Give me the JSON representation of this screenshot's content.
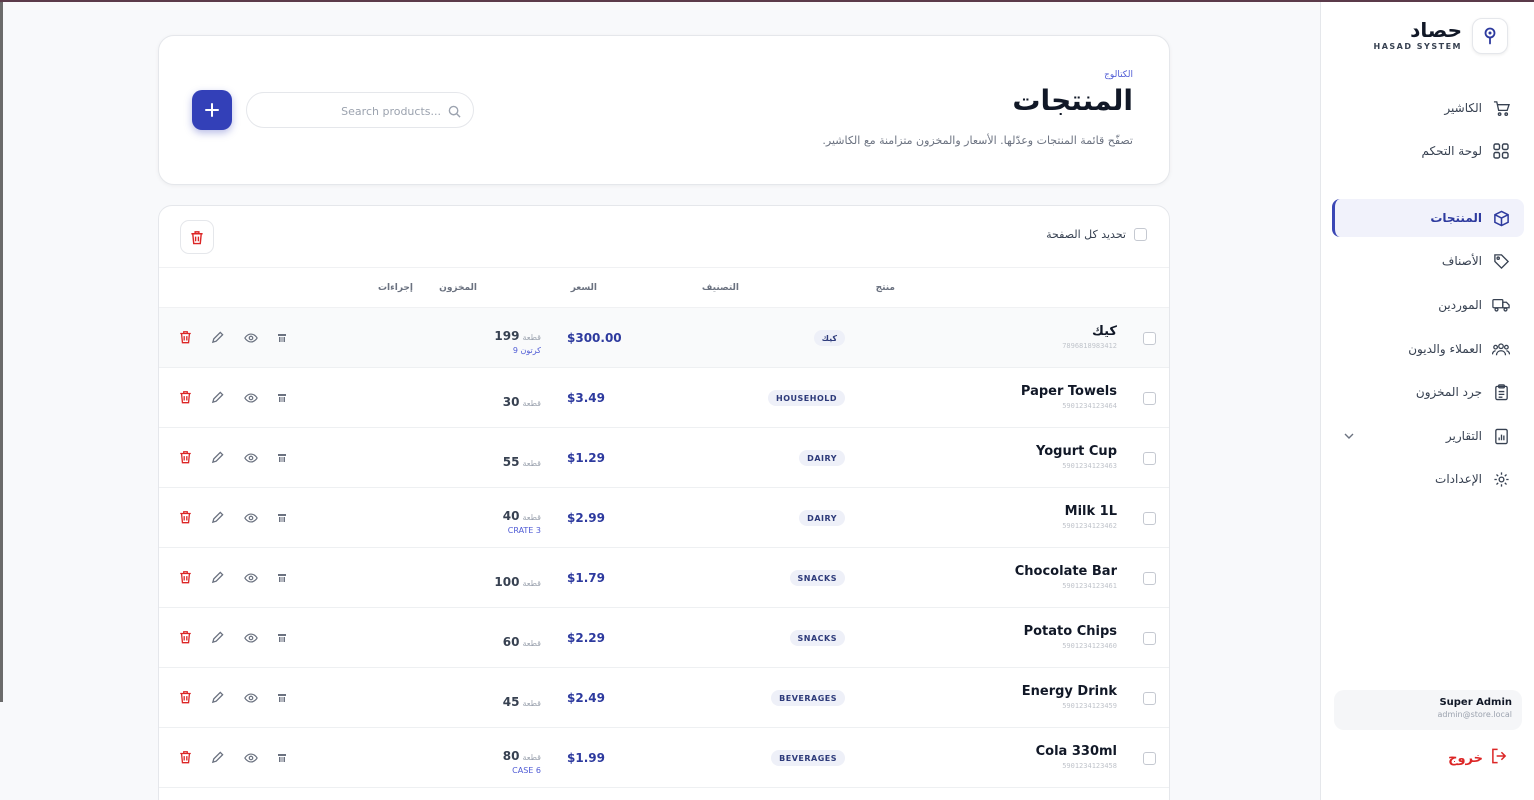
{
  "brand": {
    "name": "حصاد",
    "sub": "HASAD SYSTEM"
  },
  "nav": [
    {
      "label": "الكاشير",
      "icon": "cart-icon"
    },
    {
      "label": "لوحة التحكم",
      "icon": "grid-icon"
    },
    {
      "label": "المنتجات",
      "icon": "box-icon",
      "active": true
    },
    {
      "label": "الأصناف",
      "icon": "tag-icon"
    },
    {
      "label": "الموردين",
      "icon": "truck-icon"
    },
    {
      "label": "العملاء والديون",
      "icon": "users-icon"
    },
    {
      "label": "جرد المخزون",
      "icon": "clipboard-icon"
    },
    {
      "label": "التقارير",
      "icon": "chart-file-icon",
      "expandable": true
    },
    {
      "label": "الإعدادات",
      "icon": "gear-icon"
    }
  ],
  "user": {
    "name": "Super Admin",
    "email": "admin@store.local"
  },
  "logout_label": "خروج",
  "header": {
    "crumb": "الكتالوج",
    "title": "المنتجات",
    "description": "تصفّح قائمة المنتجات وعدّلها. الأسعار والمخزون متزامنة مع الكاشير.",
    "search_placeholder": "Search products..."
  },
  "table": {
    "select_all_label": "تحديد كل الصفحة",
    "columns": {
      "product": "منتج",
      "category": "التصنيف",
      "price": "السعر",
      "stock": "المخزون",
      "actions": "إجراءات"
    },
    "rows": [
      {
        "name": "كيك",
        "code": "7896818983412",
        "category": "كيك",
        "price": "$300.00",
        "qty": "199",
        "unit": "قطعة",
        "pack": "9 كرتون"
      },
      {
        "name": "Paper Towels",
        "code": "5901234123464",
        "category": "HOUSEHOLD",
        "price": "$3.49",
        "qty": "30",
        "unit": "قطعة",
        "pack": ""
      },
      {
        "name": "Yogurt Cup",
        "code": "5901234123463",
        "category": "DAIRY",
        "price": "$1.29",
        "qty": "55",
        "unit": "قطعة",
        "pack": ""
      },
      {
        "name": "Milk 1L",
        "code": "5901234123462",
        "category": "DAIRY",
        "price": "$2.99",
        "qty": "40",
        "unit": "قطعة",
        "pack": "CRATE 3"
      },
      {
        "name": "Chocolate Bar",
        "code": "5901234123461",
        "category": "SNACKS",
        "price": "$1.79",
        "qty": "100",
        "unit": "قطعة",
        "pack": ""
      },
      {
        "name": "Potato Chips",
        "code": "5901234123460",
        "category": "SNACKS",
        "price": "$2.29",
        "qty": "60",
        "unit": "قطعة",
        "pack": ""
      },
      {
        "name": "Energy Drink",
        "code": "5901234123459",
        "category": "BEVERAGES",
        "price": "$2.49",
        "qty": "45",
        "unit": "قطعة",
        "pack": ""
      },
      {
        "name": "Cola 330ml",
        "code": "5901234123458",
        "category": "BEVERAGES",
        "price": "$1.99",
        "qty": "80",
        "unit": "قطعة",
        "pack": "CASE 6"
      }
    ]
  },
  "colors": {
    "accent": "#3340b8",
    "danger": "#dc2626",
    "link": "#4f5bd5"
  }
}
